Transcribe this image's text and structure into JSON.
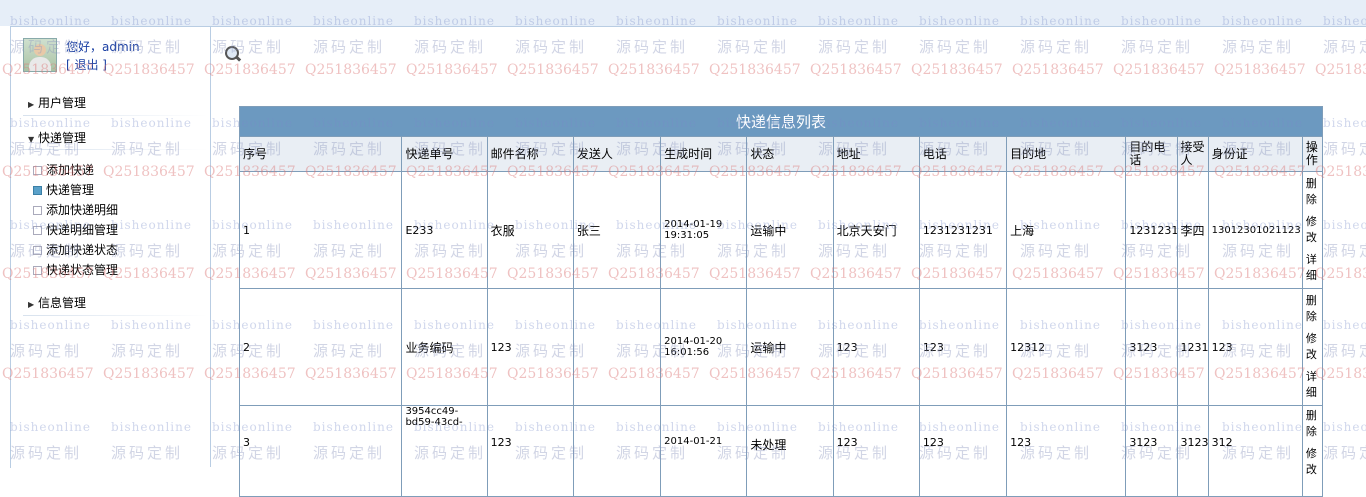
{
  "user": {
    "greeting": "您好，admin",
    "logout": "[ 退出 ]"
  },
  "sidebar": {
    "groups": [
      {
        "label": "用户管理",
        "expanded": false
      },
      {
        "label": "快递管理",
        "expanded": true
      },
      {
        "label": "信息管理",
        "expanded": false
      }
    ],
    "items": [
      {
        "label": "添加快递"
      },
      {
        "label": "快递管理",
        "active": true
      },
      {
        "label": "添加快递明细"
      },
      {
        "label": "快递明细管理"
      },
      {
        "label": "添加快递状态"
      },
      {
        "label": "快递状态管理"
      }
    ]
  },
  "table": {
    "title": "快递信息列表",
    "headers": [
      "序号",
      "快递单号",
      "邮件名称",
      "发送人",
      "生成时间",
      "状态",
      "地址",
      "电话",
      "目的地",
      "目的电话",
      "接受人",
      "身份证",
      "操作"
    ],
    "rows": [
      {
        "no": "1",
        "tracking": "E233",
        "name": "衣服",
        "sender": "张三",
        "time": "2014-01-19 19:31:05",
        "status": "运输中",
        "address": "北京天安门",
        "phone": "1231231231",
        "dest": "上海",
        "dest_phone": "1231231",
        "receiver": "李四",
        "id_card": "13012301021123"
      },
      {
        "no": "2",
        "tracking": "业务编码",
        "name": "123",
        "sender": "",
        "time": "2014-01-20 16:01:56",
        "status": "运输中",
        "address": "123",
        "phone": "123",
        "dest": "12312",
        "dest_phone": "3123",
        "receiver": "1231",
        "id_card": "123"
      },
      {
        "no": "3",
        "tracking": "3954cc49-bd59-43cd-",
        "name": "123",
        "sender": "",
        "time": "2014-01-21",
        "status": "未处理",
        "address": "123",
        "phone": "123",
        "dest": "123",
        "dest_phone": "3123",
        "receiver": "3123",
        "id_card": "312"
      }
    ],
    "actions": {
      "delete": "删除",
      "edit": "修改",
      "detail": "详细"
    }
  },
  "watermark": {
    "en": "bisheonline",
    "cn": "源码定制",
    "qq": "Q251836457"
  },
  "colors": {
    "caption_bg": "#6c99c0",
    "header_bg": "#e9eef4",
    "border": "#7f9db9",
    "link": "#1a3fa3"
  },
  "icons": [
    "search-icon",
    "avatar",
    "triangle-right-icon",
    "triangle-down-icon",
    "square-bullet-icon"
  ]
}
